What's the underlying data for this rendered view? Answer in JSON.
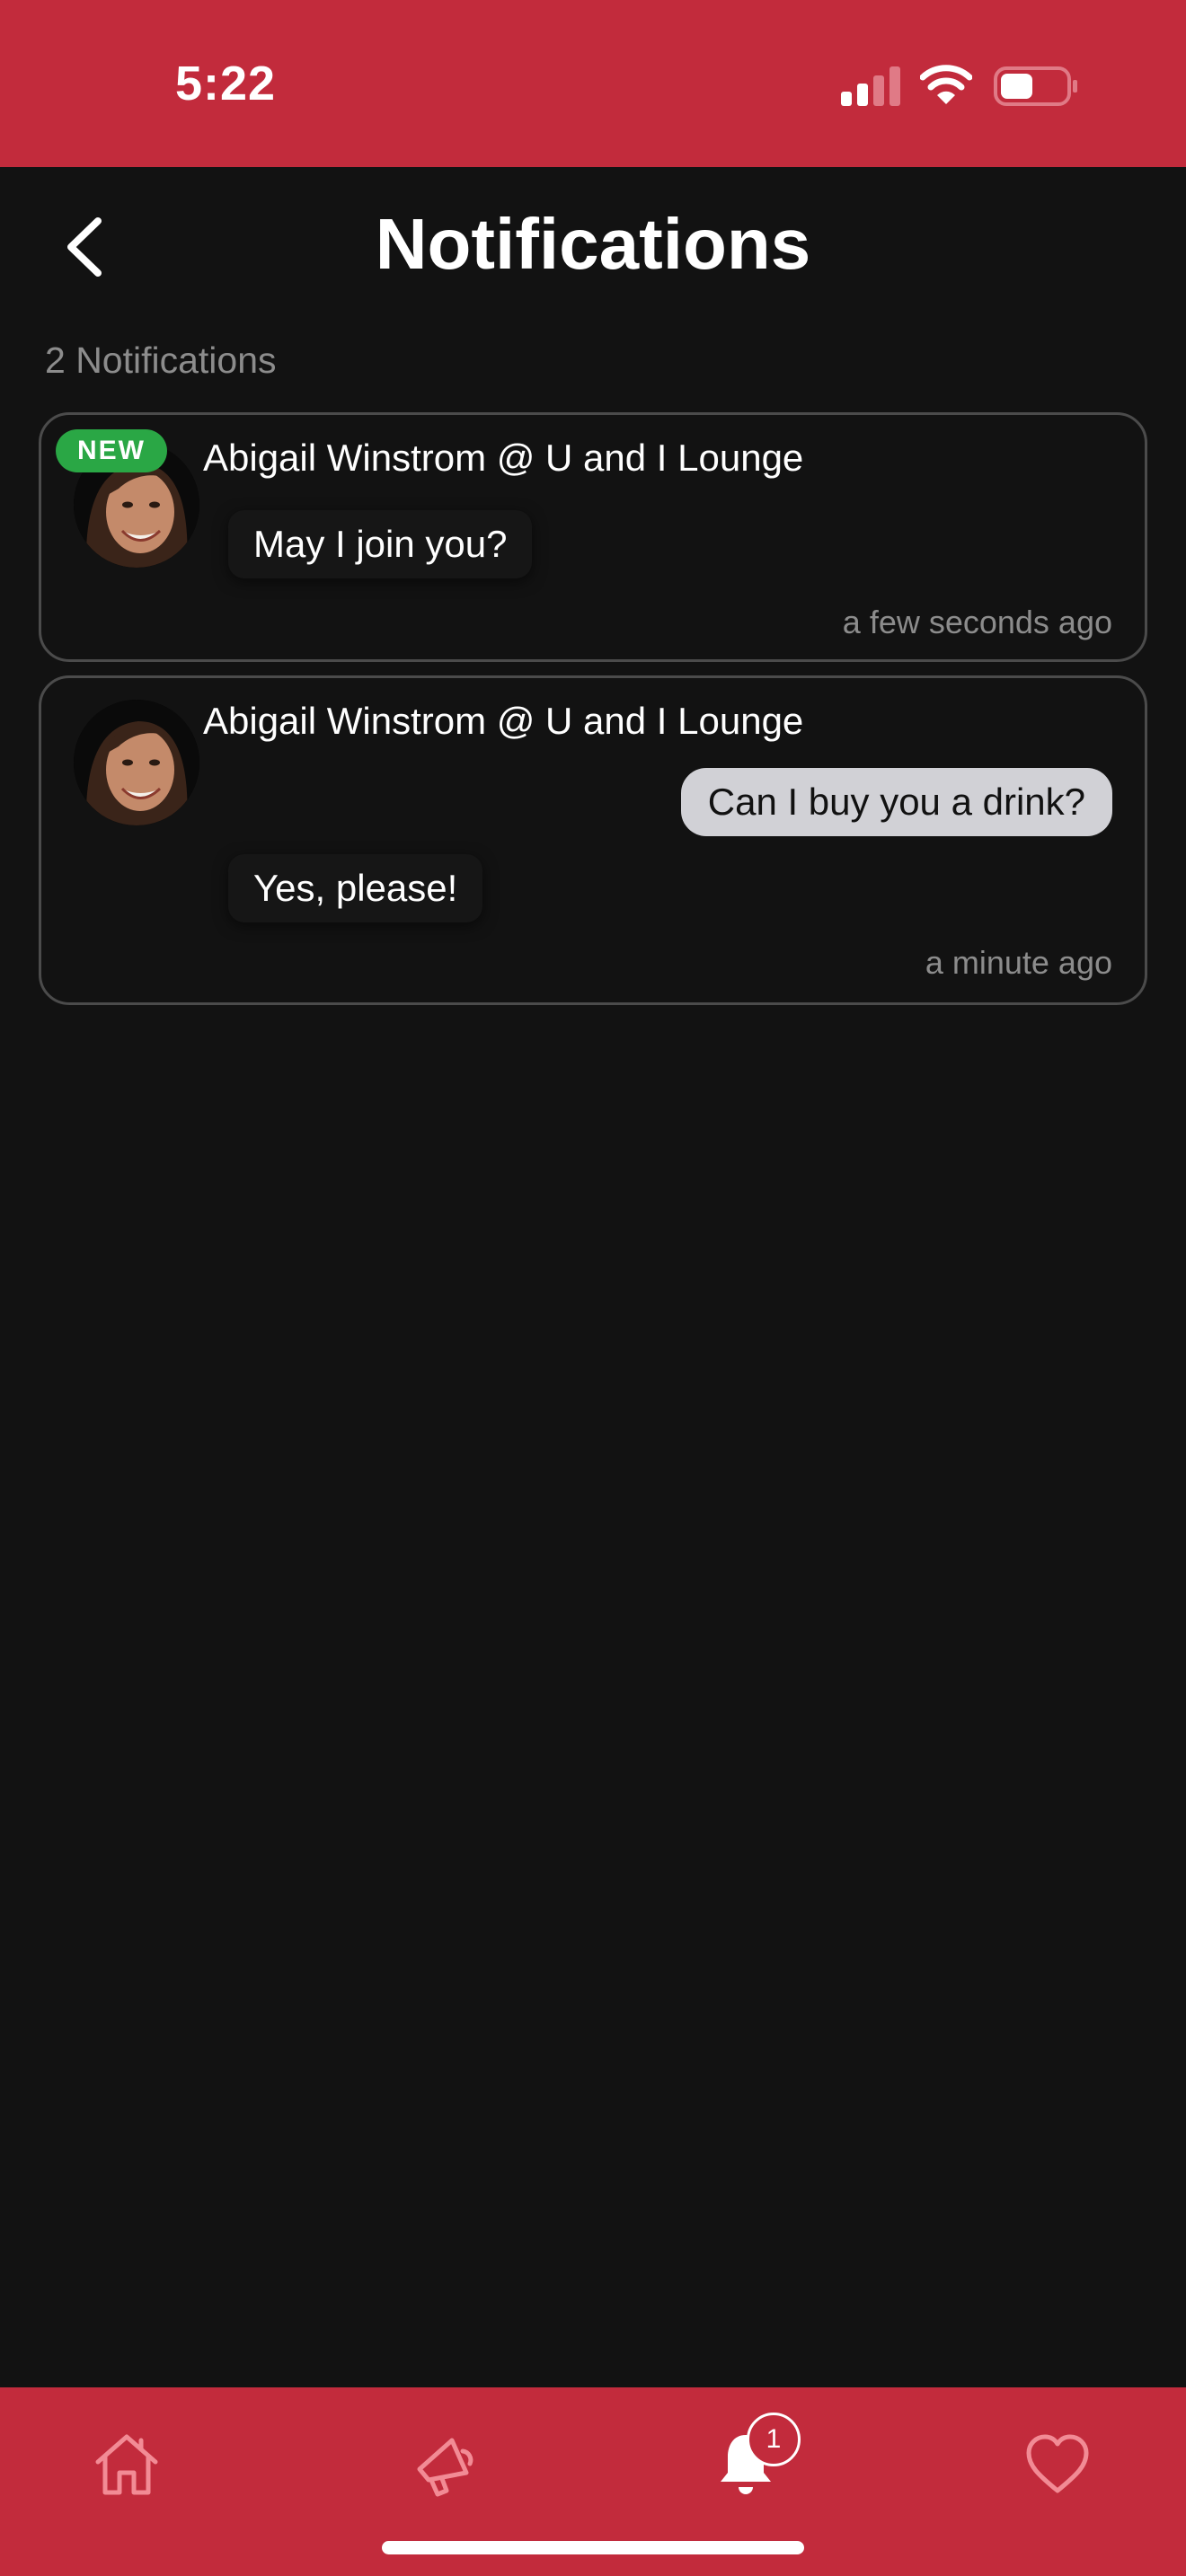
{
  "status_bar": {
    "time": "5:22",
    "icons": [
      "signal-icon",
      "wifi-icon",
      "battery-icon"
    ],
    "battery_level": 0.5
  },
  "header": {
    "title": "Notifications",
    "back_icon": "chevron-left-icon"
  },
  "notifications_count_label": "2 Notifications",
  "notifications": [
    {
      "badge": "NEW",
      "sender": "Abigail Winstrom @ U and I Lounge",
      "incoming_message": "May I join you?",
      "time_ago": "a few seconds ago"
    },
    {
      "sender": "Abigail Winstrom @ U and I Lounge",
      "outgoing_message": "Can I buy you a drink?",
      "incoming_message": "Yes, please!",
      "time_ago": "a minute ago"
    }
  ],
  "tab_bar": {
    "items": [
      {
        "icon": "home-icon",
        "active": false
      },
      {
        "icon": "megaphone-icon",
        "active": false
      },
      {
        "icon": "bell-icon",
        "active": true,
        "badge": "1"
      },
      {
        "icon": "heart-icon",
        "active": false
      }
    ]
  },
  "colors": {
    "brand_red": "#c22b3c",
    "background": "#121212",
    "new_badge_green": "#2aa745",
    "outgoing_bubble": "#d1d1d6",
    "muted_text": "#8c8c8c",
    "inactive_tab_icon": "#f28b95"
  }
}
